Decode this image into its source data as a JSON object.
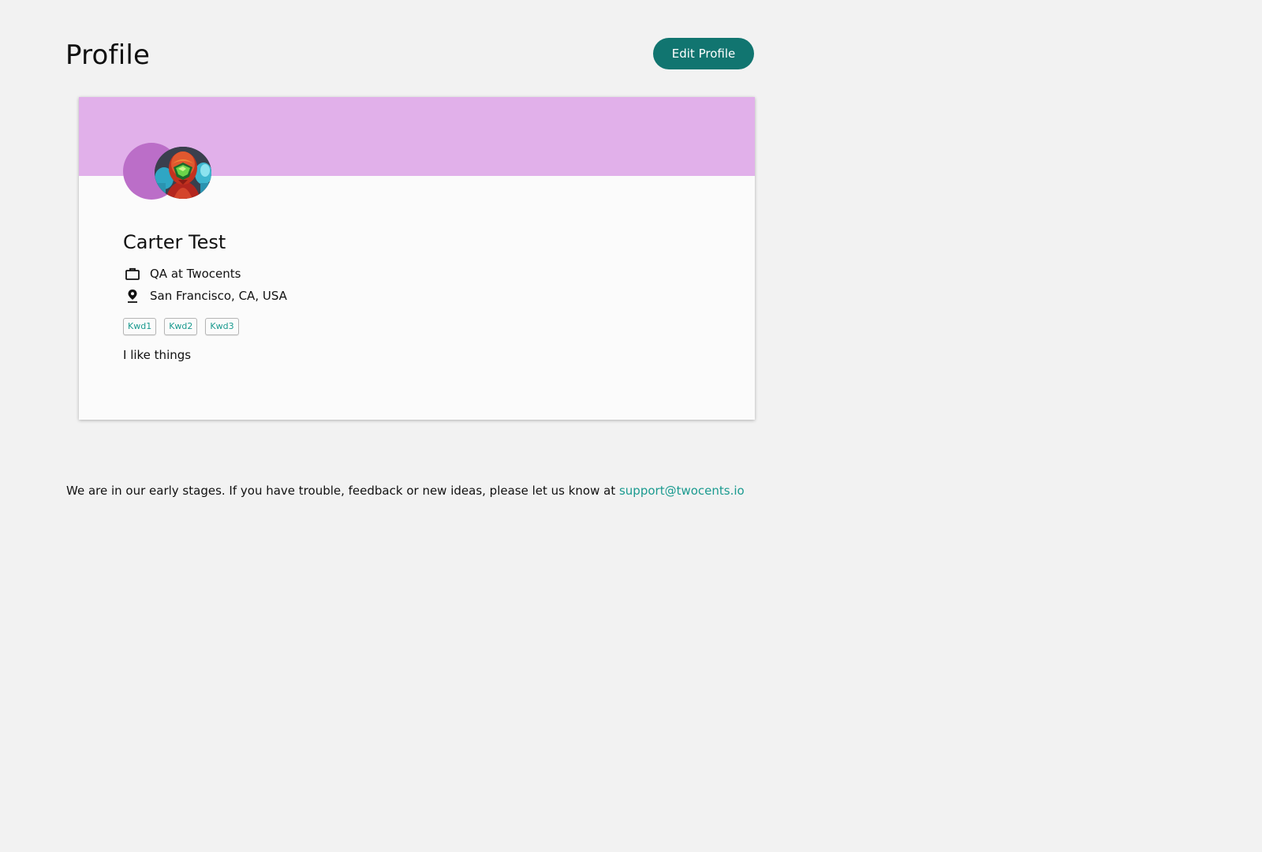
{
  "header": {
    "title": "Profile",
    "edit_button_label": "Edit Profile"
  },
  "profile": {
    "name": "Carter Test",
    "job": "QA at Twocents",
    "location": "San Francisco, CA, USA",
    "keywords": [
      "Kwd1",
      "Kwd2",
      "Kwd3"
    ],
    "bio": "I like things",
    "icons": {
      "job": "briefcase-icon",
      "location": "location-pin-icon"
    },
    "avatar": "armored-helmet-character-avatar"
  },
  "footer": {
    "message": "We are in our early stages. If you have trouble, feedback or new ideas, please let us know at ",
    "support_email": "support@twocents.io"
  },
  "colors": {
    "background": "#f2f2f2",
    "primary_button": "#117570",
    "banner": "#e1b0ea",
    "avatar_accent": "#bb6ec8",
    "link": "#1a9a8f",
    "card": "#fbfbfb"
  }
}
